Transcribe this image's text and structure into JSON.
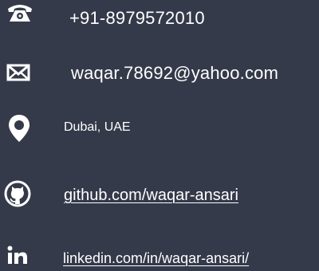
{
  "contacts": {
    "phone": {
      "icon": "telephone-icon",
      "text": "+91-8979572010"
    },
    "email": {
      "icon": "envelope-icon",
      "text": "waqar.78692@yahoo.com"
    },
    "location": {
      "icon": "map-pin-icon",
      "text": "Dubai, UAE"
    },
    "github": {
      "icon": "github-icon",
      "text": "github.com/waqar-ansari"
    },
    "linkedin": {
      "icon": "linkedin-icon",
      "text": "linkedin.com/in/waqar-ansari/"
    }
  },
  "colors": {
    "background": "#343a4a",
    "foreground": "#ffffff"
  }
}
